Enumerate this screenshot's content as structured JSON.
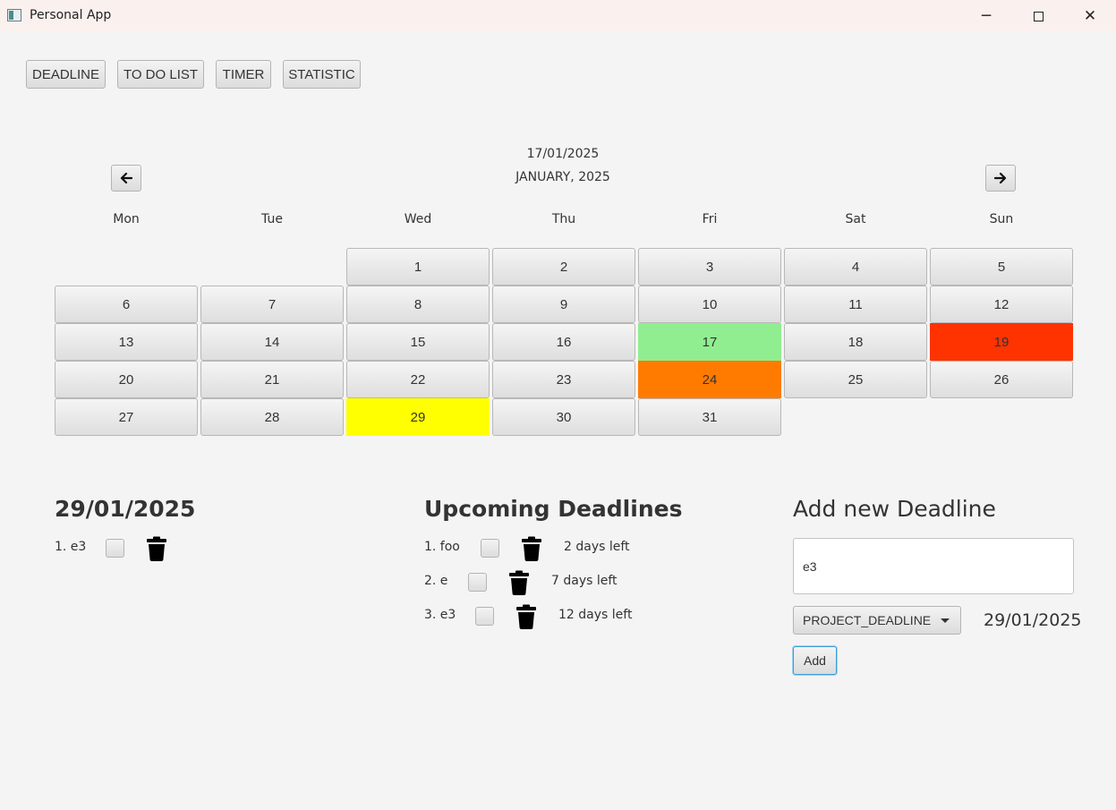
{
  "window": {
    "title": "Personal App",
    "minimize": "─",
    "close": "✕"
  },
  "nav": {
    "deadline": "DEADLINE",
    "todo": "TO DO LIST",
    "timer": "TIMER",
    "statistic": "STATISTIC"
  },
  "calendar": {
    "current_date": "17/01/2025",
    "month_label": "JANUARY, 2025",
    "weekdays": [
      "Mon",
      "Tue",
      "Wed",
      "Thu",
      "Fri",
      "Sat",
      "Sun"
    ],
    "days": [
      "1",
      "2",
      "3",
      "4",
      "5",
      "6",
      "7",
      "8",
      "9",
      "10",
      "11",
      "12",
      "13",
      "14",
      "15",
      "16",
      "17",
      "18",
      "19",
      "20",
      "21",
      "22",
      "23",
      "24",
      "25",
      "26",
      "27",
      "28",
      "29",
      "30",
      "31"
    ],
    "highlight_colors": {
      "17": "#90ee90",
      "19": "#ff3300",
      "24": "#ff7b00",
      "29": "#ffff00"
    }
  },
  "selected": {
    "date": "29/01/2025",
    "items": [
      {
        "label": "1. e3"
      }
    ]
  },
  "upcoming": {
    "title": "Upcoming Deadlines",
    "items": [
      {
        "label": "1. foo",
        "days_left": "2 days left"
      },
      {
        "label": "2. e",
        "days_left": "7 days left"
      },
      {
        "label": "3. e3",
        "days_left": "12 days left"
      }
    ]
  },
  "add_form": {
    "title": "Add new Deadline",
    "name_value": "e3",
    "type_selected": "PROJECT_DEADLINE",
    "date": "29/01/2025",
    "add_label": "Add"
  },
  "icons": {
    "prev": "arrow-left-icon",
    "next": "arrow-right-icon",
    "delete": "trash-icon",
    "dropdown": "chevron-down-icon"
  }
}
